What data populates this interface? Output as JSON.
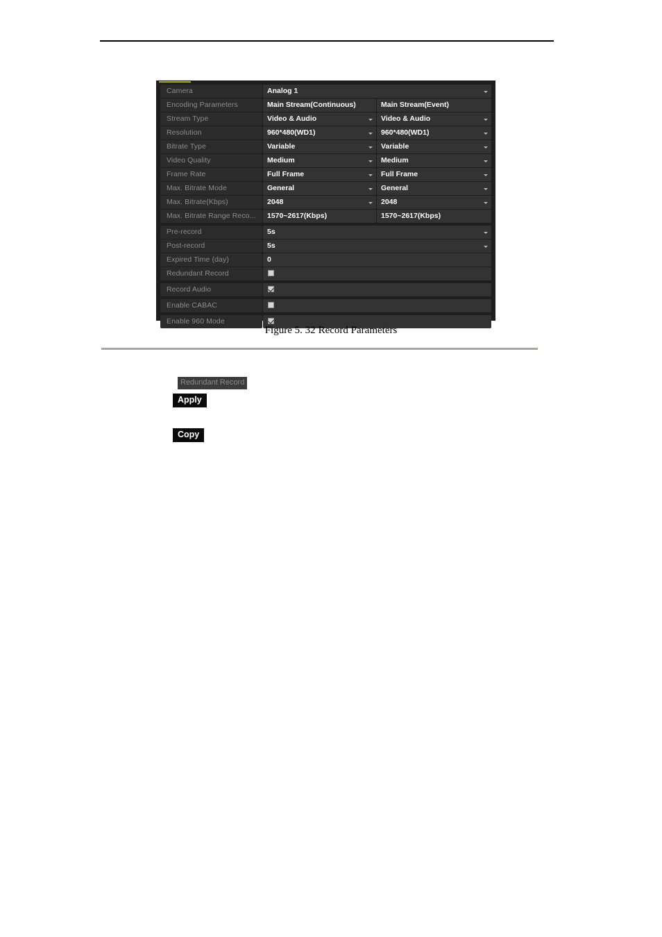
{
  "page": {
    "caption_number": "Figure 5. 32",
    "caption_text": "Record Parameters"
  },
  "dialog": {
    "rows": [
      {
        "label": "Camera",
        "value1": "Analog 1",
        "type": "single-select"
      },
      {
        "label": "Encoding Parameters",
        "value1": "Main Stream(Continuous)",
        "value2": "Main Stream(Event)",
        "type": "header"
      },
      {
        "label": "Stream Type",
        "value1": "Video & Audio",
        "value2": "Video & Audio",
        "type": "dual-select"
      },
      {
        "label": "Resolution",
        "value1": "960*480(WD1)",
        "value2": "960*480(WD1)",
        "type": "dual-select"
      },
      {
        "label": "Bitrate Type",
        "value1": "Variable",
        "value2": "Variable",
        "type": "dual-select"
      },
      {
        "label": "Video Quality",
        "value1": "Medium",
        "value2": "Medium",
        "type": "dual-select"
      },
      {
        "label": "Frame Rate",
        "value1": "Full Frame",
        "value2": "Full Frame",
        "type": "dual-select"
      },
      {
        "label": "Max. Bitrate Mode",
        "value1": "General",
        "value2": "General",
        "type": "dual-select"
      },
      {
        "label": "Max. Bitrate(Kbps)",
        "value1": "2048",
        "value2": "2048",
        "type": "dual-select"
      },
      {
        "label": "Max. Bitrate Range Reco...",
        "value1": "1570~2617(Kbps)",
        "value2": "1570~2617(Kbps)",
        "type": "dual-text"
      },
      {
        "label": "Pre-record",
        "value1": "5s",
        "type": "single-select"
      },
      {
        "label": "Post-record",
        "value1": "5s",
        "type": "single-select"
      },
      {
        "label": "Expired Time (day)",
        "value1": "0",
        "type": "single-text"
      },
      {
        "label": "Redundant Record",
        "checked": false,
        "type": "checkbox"
      },
      {
        "label": "Record Audio",
        "checked": true,
        "type": "checkbox"
      },
      {
        "label": "Enable CABAC",
        "checked": false,
        "type": "checkbox"
      },
      {
        "label": "Enable 960 Mode",
        "checked": true,
        "type": "checkbox"
      }
    ]
  },
  "tokens": {
    "redundant_record": "Redundant Record",
    "apply": "Apply",
    "copy": "Copy"
  },
  "colors": {
    "panel_bg": "#1e1e1e",
    "label_bg": "#2b2b2b",
    "value_bg": "#333333",
    "label_text": "#8d8d8d",
    "value_text": "#ffffff",
    "accent": "#adad1f",
    "rule_top": "#000000",
    "rule_mid": "#a7a79c"
  }
}
